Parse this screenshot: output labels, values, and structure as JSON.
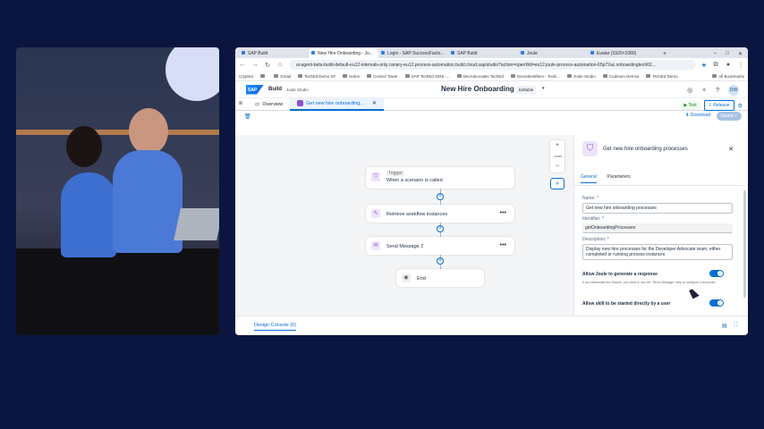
{
  "browser": {
    "tabs": [
      {
        "label": "SAP Build"
      },
      {
        "label": "New Hire Onboarding - Jo..."
      },
      {
        "label": "Login - SAP SuccessFacto..."
      },
      {
        "label": "SAP Build"
      },
      {
        "label": "Joule"
      },
      {
        "label": "Evatar (1920×1080)"
      }
    ],
    "new_tab": "+",
    "url": "ai-agent-beta-build-default-eu12-internals-only.canary-eu12.process-automation.build.cloud.sap/studio?action=openWd=eu12.joule-process-automation-65p72ac.onboardingtech62...",
    "bookmarks": [
      "Cryptics",
      "Gmail",
      "TechEd Demo SF",
      "Notes",
      "Control Tower",
      "SAP TechEd 2025 -...",
      "DevAdvocates TechEd",
      "DevoIdentifiers - Tools...",
      "Joule Studio",
      "Codeium Demos",
      "TechEd Demo"
    ],
    "all_bookmarks": "All Bookmarks"
  },
  "shell": {
    "logo": "SAP",
    "product": "Build",
    "subproduct": "Joule Studio",
    "title": "New Hire Onboarding",
    "status": "Editable",
    "avatar": "DW"
  },
  "subbar": {
    "overview_tab": "Overview",
    "active_tab": "Get new hire onboarding...",
    "test": "Test",
    "release": "Release",
    "download": "Download",
    "saved": "Saved"
  },
  "canvas": {
    "trigger_tag": "Trigger",
    "trigger_label": "When a scenario is called",
    "steps": [
      "Retrieve workflow instances",
      "Send Message 2"
    ],
    "end": "End",
    "zoom_level": "- zoom"
  },
  "panel": {
    "title": "Get new hire onboarding processes",
    "tabs": [
      "General",
      "Parameters"
    ],
    "name_label": "Name: *",
    "name_value": "Get new hire onboarding processes",
    "identifier_label": "Identifier: *",
    "identifier_value": "getOnboardingProcesses",
    "description_label": "Description: *",
    "description_value": "Display new hire processes for the Developer Advocate team, either completed or running process instances",
    "toggle1_label": "Allow Joule to generate a response",
    "toggle1_hint": "If you deactivate this feature, you need to use the \"Send Message\" step to configure a response.",
    "toggle2_label": "Allow skill to be started directly by a user"
  },
  "bottom": {
    "console": "Design Console (0)"
  },
  "colors": {
    "accent": "#0a6ed1",
    "page_bg": "#0b1640",
    "skill_purple": "#8c4fd1"
  }
}
